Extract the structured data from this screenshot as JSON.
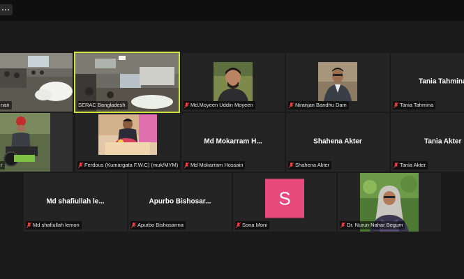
{
  "meeting": {
    "participants": [
      {
        "label": "nan",
        "big_name": "",
        "type": "video"
      },
      {
        "label": "SERAC Bangladesh",
        "big_name": "",
        "type": "video",
        "active": true
      },
      {
        "label": "Md.Moyeen Uddin Moyeen",
        "big_name": "",
        "type": "photo"
      },
      {
        "label": "Niranjan Bandhu Dam",
        "big_name": "",
        "type": "photo"
      },
      {
        "label": "Tania Tahmina",
        "big_name": "Tania Tahmina",
        "type": "name"
      },
      {
        "label": "r",
        "big_name": "",
        "type": "video"
      },
      {
        "label": "Ferdous (Kumargata F.W.C) (muk/MYM)",
        "big_name": "",
        "type": "photo"
      },
      {
        "label": "Md Mokarram Hossain",
        "big_name": "Md  Mokarram  H...",
        "type": "name"
      },
      {
        "label": "Shahena Akter",
        "big_name": "Shahena Akter",
        "type": "name"
      },
      {
        "label": "Tania Akter",
        "big_name": "Tania Akter",
        "type": "name"
      },
      {
        "label": "Md shafiullah lemon",
        "big_name": "Md  shafiullah  le...",
        "type": "name"
      },
      {
        "label": "Apurbo Bishosarma",
        "big_name": "Apurbo  Bishosar...",
        "type": "name"
      },
      {
        "label": "Sona Moni",
        "big_name": "",
        "type": "avatar",
        "avatar_letter": "S"
      },
      {
        "label": "Dr. Nurun Nahar Begum",
        "big_name": "",
        "type": "photo"
      }
    ]
  },
  "colors": {
    "muted_mic": "#e8413b",
    "active_border": "#cfe33a",
    "avatar_bg": "#e84a7d",
    "tile_bg": "#242424"
  }
}
